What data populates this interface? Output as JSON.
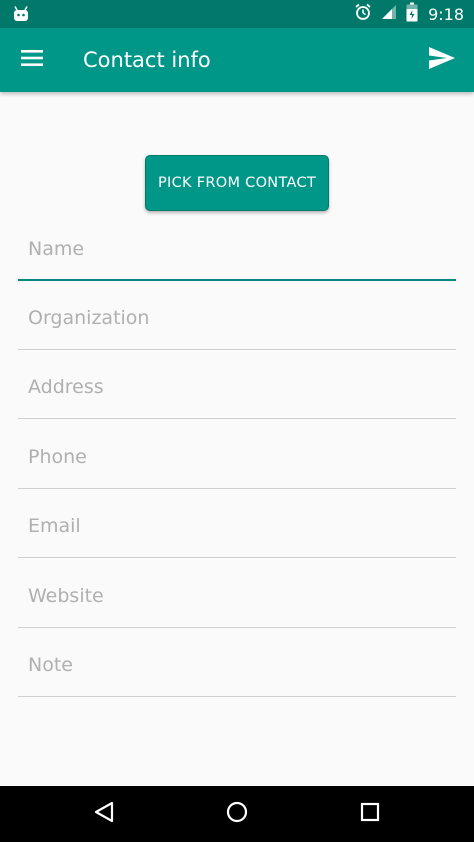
{
  "status_bar": {
    "time": "9:18",
    "left_icon": "android-icon",
    "icons": [
      "alarm-icon",
      "signal-icon",
      "battery-icon"
    ]
  },
  "app_bar": {
    "title": "Contact info",
    "menu_icon": "menu-icon",
    "action_icon": "send-icon"
  },
  "pick_button": {
    "label": "PICK FROM CONTACT"
  },
  "fields": {
    "name": {
      "placeholder": "Name",
      "value": ""
    },
    "organization": {
      "placeholder": "Organization",
      "value": ""
    },
    "address": {
      "placeholder": "Address",
      "value": ""
    },
    "phone": {
      "placeholder": "Phone",
      "value": ""
    },
    "email": {
      "placeholder": "Email",
      "value": ""
    },
    "website": {
      "placeholder": "Website",
      "value": ""
    },
    "note": {
      "placeholder": "Note",
      "value": ""
    }
  },
  "nav_bar": {
    "icons": [
      "back-icon",
      "home-icon",
      "recents-icon"
    ]
  },
  "colors": {
    "status_bar": "#00796b",
    "app_bar": "#009688",
    "accent": "#00897b",
    "background": "#fafafa",
    "placeholder": "#b0b0b0",
    "divider": "#cfcfcf"
  }
}
